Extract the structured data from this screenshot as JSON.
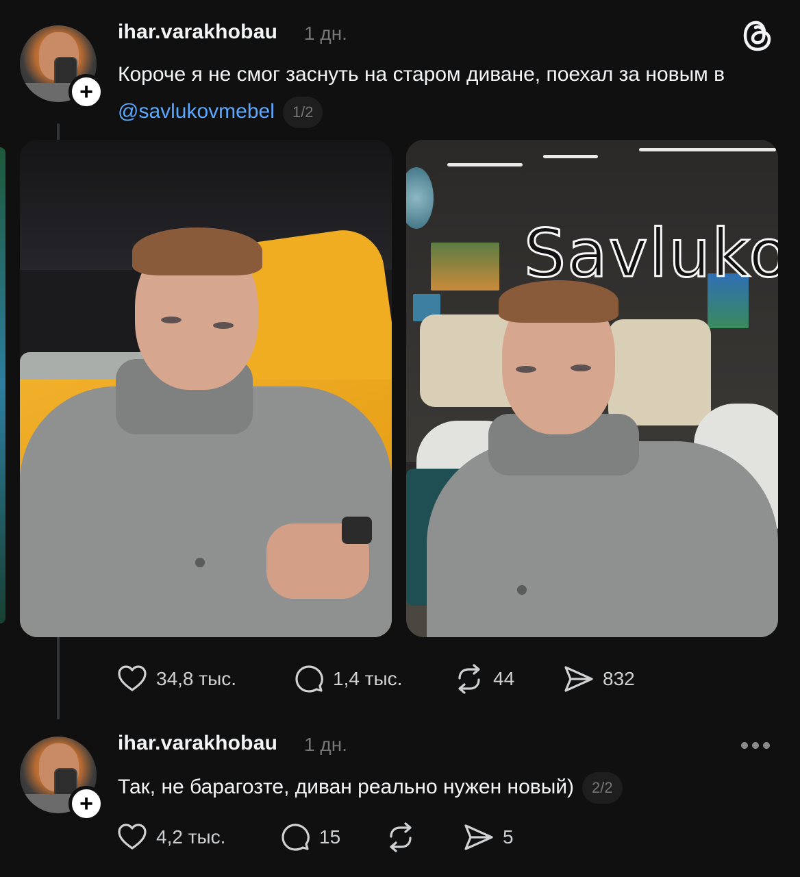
{
  "colors": {
    "background": "#101010",
    "text": "#f3f5f7",
    "muted": "#777777",
    "mention": "#5aa8ff",
    "icon": "#cfd1d3"
  },
  "post1": {
    "username": "ihar.varakhobau",
    "timestamp": "1 дн.",
    "text_before_mention": "Короче я не смог заснуть на старом диване, поехал за новым в ",
    "mention": "@savlukovmebel",
    "page_indicator": "1/2",
    "header_icon": "threads-logo-icon",
    "media": [
      {
        "name": "photo-yellow-sofa-selfie"
      },
      {
        "name": "photo-showroom-selfie",
        "sign_text": "Savluko"
      }
    ],
    "actions": {
      "likes": "34,8 тыс.",
      "replies": "1,4 тыс.",
      "reposts": "44",
      "shares": "832"
    }
  },
  "post2": {
    "username": "ihar.varakhobau",
    "timestamp": "1 дн.",
    "text": "Так, не барагозте, диван реально нужен новый)",
    "page_indicator": "2/2",
    "actions": {
      "likes": "4,2 тыс.",
      "replies": "15",
      "reposts": "",
      "shares": "5"
    }
  }
}
